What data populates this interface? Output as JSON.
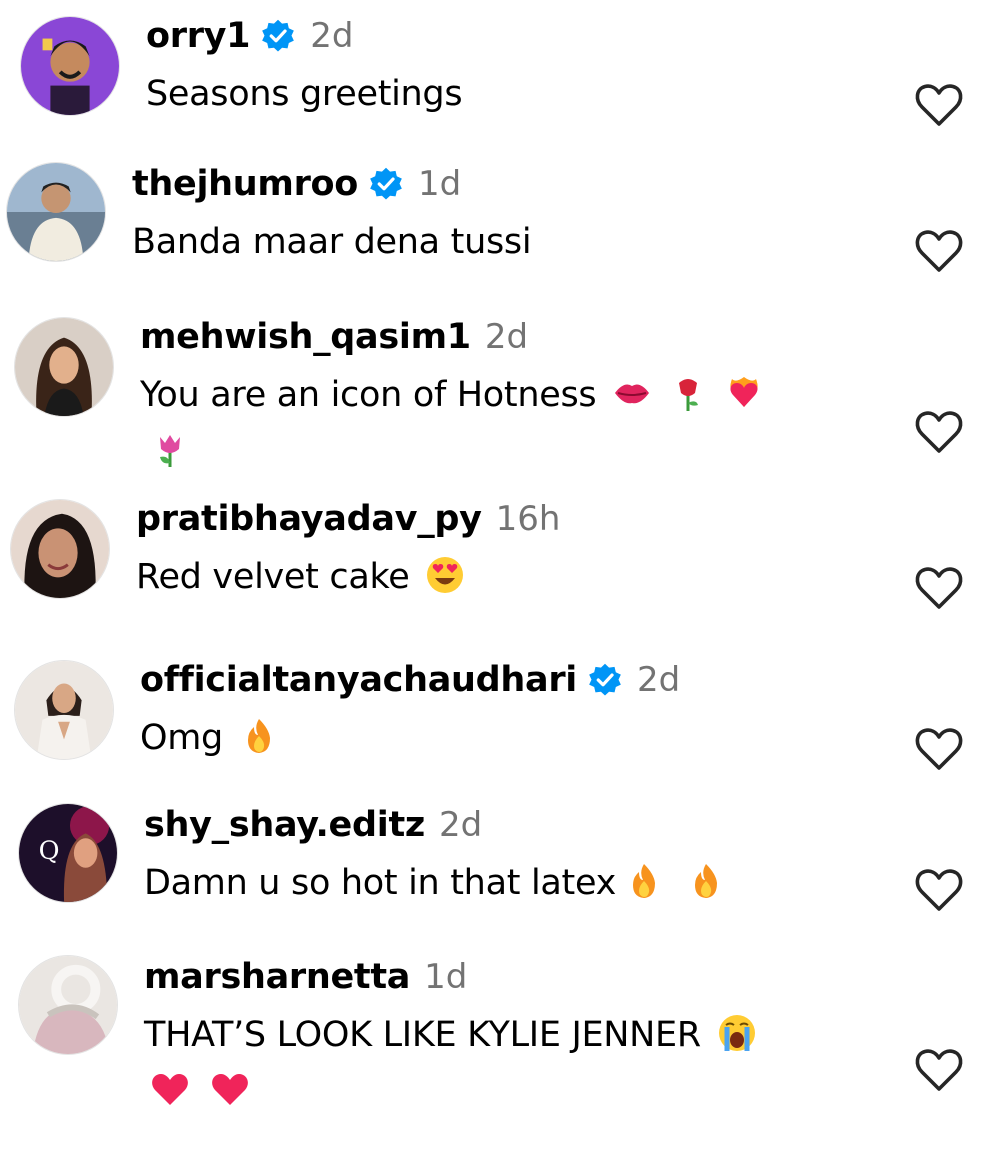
{
  "comments": [
    {
      "username": "orry1",
      "verified": true,
      "time": "2d",
      "text": "Seasons greetings",
      "emojis": []
    },
    {
      "username": "thejhumroo",
      "verified": true,
      "time": "1d",
      "text": "Banda maar dena tussi",
      "emojis": []
    },
    {
      "username": "mehwish_qasim1",
      "verified": false,
      "time": "2d",
      "text": "You are an icon of Hotness",
      "emojis": [
        "lips",
        "rose",
        "heart-on-fire",
        "tulip"
      ]
    },
    {
      "username": "pratibhayadav_py",
      "verified": false,
      "time": "16h",
      "text": "Red velvet cake",
      "emojis": [
        "heart-eyes"
      ]
    },
    {
      "username": "officialtanyachaudhari",
      "verified": true,
      "time": "2d",
      "text": "Omg",
      "emojis": [
        "fire"
      ]
    },
    {
      "username": "shy_shay.editz",
      "verified": false,
      "time": "2d",
      "text": "Damn u so hot in that latex",
      "emojis": [
        "fire",
        "fire"
      ]
    },
    {
      "username": "marsharnetta",
      "verified": false,
      "time": "1d",
      "text": "THAT’S LOOK LIKE KYLIE JENNER",
      "emojis": [
        "crying-face",
        "red-heart",
        "red-heart"
      ]
    }
  ],
  "colors": {
    "verified": "#0095f6",
    "time": "#737373",
    "text": "#000000",
    "heart_outline": "#262626"
  },
  "icons": {
    "verified": "verified-badge-icon",
    "like": "heart-outline-icon"
  }
}
